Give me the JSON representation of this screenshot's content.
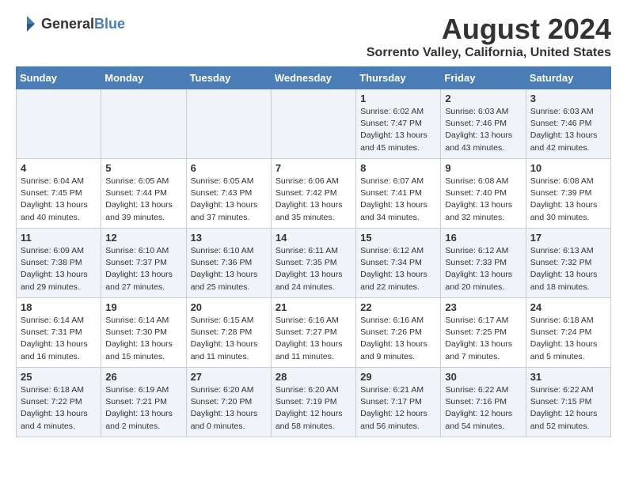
{
  "header": {
    "logo_general": "General",
    "logo_blue": "Blue",
    "month": "August 2024",
    "location": "Sorrento Valley, California, United States"
  },
  "days_of_week": [
    "Sunday",
    "Monday",
    "Tuesday",
    "Wednesday",
    "Thursday",
    "Friday",
    "Saturday"
  ],
  "weeks": [
    [
      {
        "day": "",
        "content": ""
      },
      {
        "day": "",
        "content": ""
      },
      {
        "day": "",
        "content": ""
      },
      {
        "day": "",
        "content": ""
      },
      {
        "day": "1",
        "content": "Sunrise: 6:02 AM\nSunset: 7:47 PM\nDaylight: 13 hours\nand 45 minutes."
      },
      {
        "day": "2",
        "content": "Sunrise: 6:03 AM\nSunset: 7:46 PM\nDaylight: 13 hours\nand 43 minutes."
      },
      {
        "day": "3",
        "content": "Sunrise: 6:03 AM\nSunset: 7:46 PM\nDaylight: 13 hours\nand 42 minutes."
      }
    ],
    [
      {
        "day": "4",
        "content": "Sunrise: 6:04 AM\nSunset: 7:45 PM\nDaylight: 13 hours\nand 40 minutes."
      },
      {
        "day": "5",
        "content": "Sunrise: 6:05 AM\nSunset: 7:44 PM\nDaylight: 13 hours\nand 39 minutes."
      },
      {
        "day": "6",
        "content": "Sunrise: 6:05 AM\nSunset: 7:43 PM\nDaylight: 13 hours\nand 37 minutes."
      },
      {
        "day": "7",
        "content": "Sunrise: 6:06 AM\nSunset: 7:42 PM\nDaylight: 13 hours\nand 35 minutes."
      },
      {
        "day": "8",
        "content": "Sunrise: 6:07 AM\nSunset: 7:41 PM\nDaylight: 13 hours\nand 34 minutes."
      },
      {
        "day": "9",
        "content": "Sunrise: 6:08 AM\nSunset: 7:40 PM\nDaylight: 13 hours\nand 32 minutes."
      },
      {
        "day": "10",
        "content": "Sunrise: 6:08 AM\nSunset: 7:39 PM\nDaylight: 13 hours\nand 30 minutes."
      }
    ],
    [
      {
        "day": "11",
        "content": "Sunrise: 6:09 AM\nSunset: 7:38 PM\nDaylight: 13 hours\nand 29 minutes."
      },
      {
        "day": "12",
        "content": "Sunrise: 6:10 AM\nSunset: 7:37 PM\nDaylight: 13 hours\nand 27 minutes."
      },
      {
        "day": "13",
        "content": "Sunrise: 6:10 AM\nSunset: 7:36 PM\nDaylight: 13 hours\nand 25 minutes."
      },
      {
        "day": "14",
        "content": "Sunrise: 6:11 AM\nSunset: 7:35 PM\nDaylight: 13 hours\nand 24 minutes."
      },
      {
        "day": "15",
        "content": "Sunrise: 6:12 AM\nSunset: 7:34 PM\nDaylight: 13 hours\nand 22 minutes."
      },
      {
        "day": "16",
        "content": "Sunrise: 6:12 AM\nSunset: 7:33 PM\nDaylight: 13 hours\nand 20 minutes."
      },
      {
        "day": "17",
        "content": "Sunrise: 6:13 AM\nSunset: 7:32 PM\nDaylight: 13 hours\nand 18 minutes."
      }
    ],
    [
      {
        "day": "18",
        "content": "Sunrise: 6:14 AM\nSunset: 7:31 PM\nDaylight: 13 hours\nand 16 minutes."
      },
      {
        "day": "19",
        "content": "Sunrise: 6:14 AM\nSunset: 7:30 PM\nDaylight: 13 hours\nand 15 minutes."
      },
      {
        "day": "20",
        "content": "Sunrise: 6:15 AM\nSunset: 7:28 PM\nDaylight: 13 hours\nand 11 minutes."
      },
      {
        "day": "21",
        "content": "Sunrise: 6:16 AM\nSunset: 7:27 PM\nDaylight: 13 hours\nand 11 minutes."
      },
      {
        "day": "22",
        "content": "Sunrise: 6:16 AM\nSunset: 7:26 PM\nDaylight: 13 hours\nand 9 minutes."
      },
      {
        "day": "23",
        "content": "Sunrise: 6:17 AM\nSunset: 7:25 PM\nDaylight: 13 hours\nand 7 minutes."
      },
      {
        "day": "24",
        "content": "Sunrise: 6:18 AM\nSunset: 7:24 PM\nDaylight: 13 hours\nand 5 minutes."
      }
    ],
    [
      {
        "day": "25",
        "content": "Sunrise: 6:18 AM\nSunset: 7:22 PM\nDaylight: 13 hours\nand 4 minutes."
      },
      {
        "day": "26",
        "content": "Sunrise: 6:19 AM\nSunset: 7:21 PM\nDaylight: 13 hours\nand 2 minutes."
      },
      {
        "day": "27",
        "content": "Sunrise: 6:20 AM\nSunset: 7:20 PM\nDaylight: 13 hours\nand 0 minutes."
      },
      {
        "day": "28",
        "content": "Sunrise: 6:20 AM\nSunset: 7:19 PM\nDaylight: 12 hours\nand 58 minutes."
      },
      {
        "day": "29",
        "content": "Sunrise: 6:21 AM\nSunset: 7:17 PM\nDaylight: 12 hours\nand 56 minutes."
      },
      {
        "day": "30",
        "content": "Sunrise: 6:22 AM\nSunset: 7:16 PM\nDaylight: 12 hours\nand 54 minutes."
      },
      {
        "day": "31",
        "content": "Sunrise: 6:22 AM\nSunset: 7:15 PM\nDaylight: 12 hours\nand 52 minutes."
      }
    ]
  ]
}
